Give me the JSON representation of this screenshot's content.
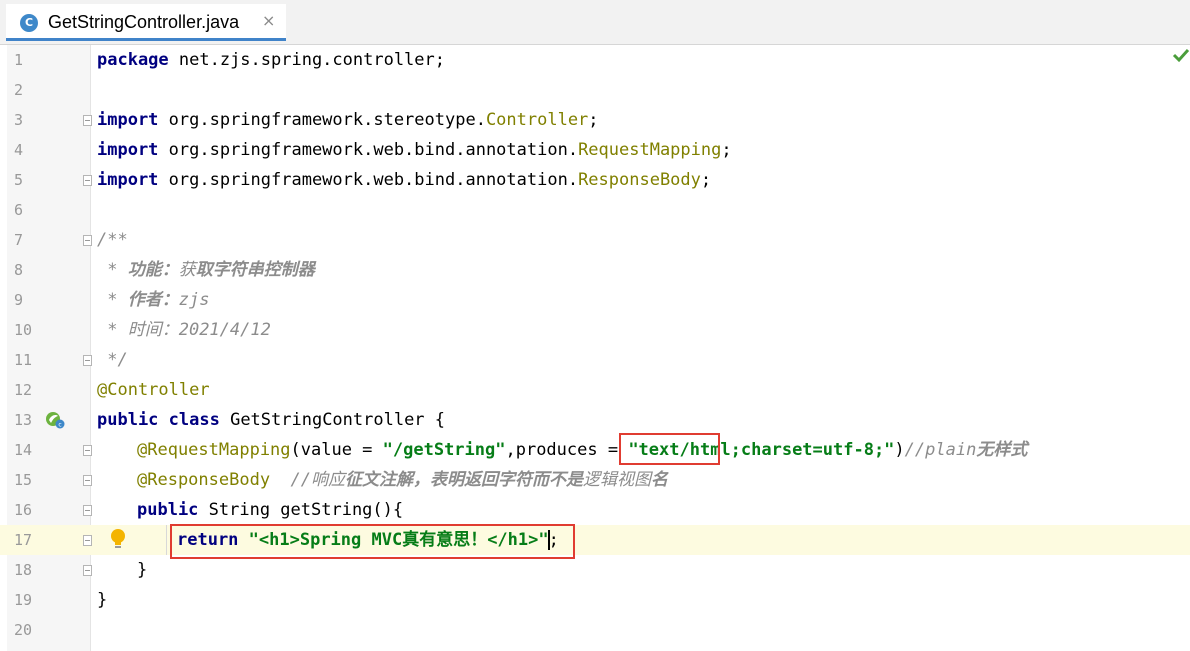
{
  "tab": {
    "title": "GetStringController.java",
    "icon": "class-c-icon",
    "close": "×"
  },
  "line_numbers": [
    "1",
    "2",
    "3",
    "4",
    "5",
    "6",
    "7",
    "8",
    "9",
    "10",
    "11",
    "12",
    "13",
    "14",
    "15",
    "16",
    "17",
    "18",
    "19",
    "20"
  ],
  "lines": {
    "l1": {
      "kw": "package",
      "rest": " net.zjs.spring.controller;"
    },
    "l3": {
      "kw": "import",
      "pkg": " org.springframework.stereotype.",
      "cls": "Controller",
      "end": ";"
    },
    "l4": {
      "kw": "import",
      "pkg": " org.springframework.web.bind.annotation.",
      "cls": "RequestMapping",
      "end": ";"
    },
    "l5": {
      "kw": "import",
      "pkg": " org.springframework.web.bind.annotation.",
      "cls": "ResponseBody",
      "end": ";"
    },
    "l7": {
      "text": "/**"
    },
    "l8": {
      "star": " * ",
      "bold": "功能：",
      "ital": "获",
      "bold2": "取字符串控制器"
    },
    "l9": {
      "star": " * ",
      "bold": "作者：",
      "ital": "zjs"
    },
    "l10": {
      "star": " * ",
      "ital": "时间：2021/4/12"
    },
    "l11": {
      "text": " */"
    },
    "l12": {
      "ann": "@Controller"
    },
    "l13": {
      "kw1": "public",
      "kw2": " class",
      "rest": " GetStringController {"
    },
    "l14": {
      "ann": "@RequestMapping",
      "p1": "(value = ",
      "s1": "\"/getString\"",
      "p2": ",produces = ",
      "s2": "\"text/html;charset=utf-8;\"",
      "p3": ")",
      "c1": "//plain",
      "c2": "无样式"
    },
    "l15": {
      "ann": "@ResponseBody",
      "c1": "  //响应",
      "c2": "征文注解，表明返回字符而不是",
      "c3": "逻辑视图",
      "c4": "名"
    },
    "l16": {
      "kw": "public",
      "rest": " String getString(){"
    },
    "l17": {
      "kw": "return",
      "sp": " ",
      "s1": "\"<h1>Spring MVC真有意思！</h1>\"",
      "end": ";"
    },
    "l18": {
      "text": "}"
    },
    "l19": {
      "text": "}"
    }
  },
  "colors": {
    "keyword": "#000080",
    "annotation": "#808000",
    "string": "#067d17",
    "comment": "#8c8c8c",
    "highlight_box": "#e03c31",
    "current_line": "#fdfbe0"
  },
  "icons": [
    "class-c-icon",
    "close-icon",
    "fold-icon",
    "spring-bean-icon",
    "lightbulb-icon",
    "checkmark-icon"
  ]
}
